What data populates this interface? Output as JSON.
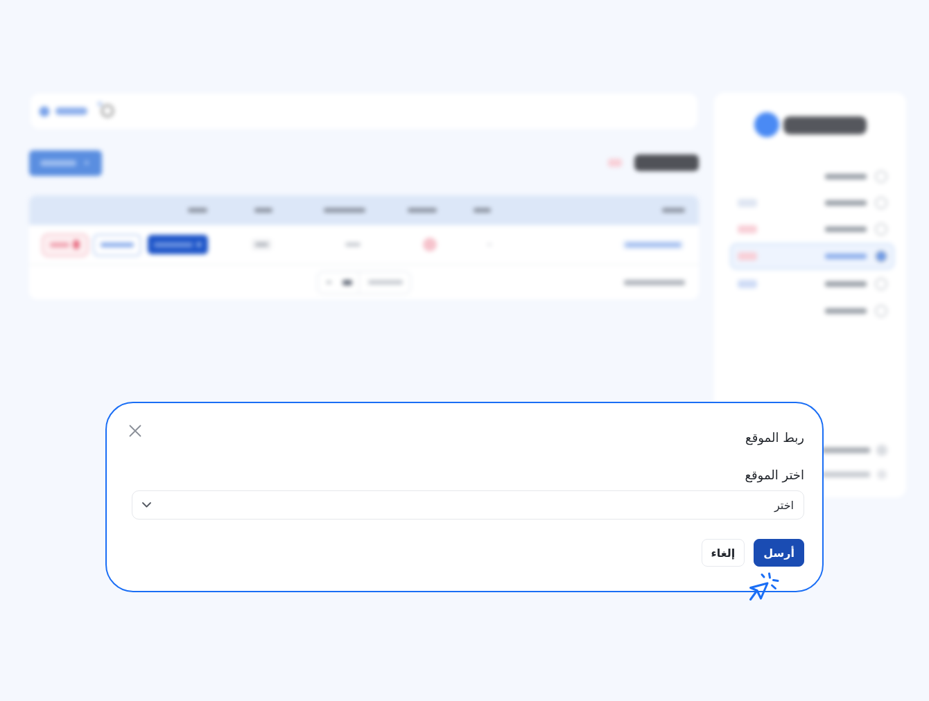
{
  "background": {
    "blurred": true
  },
  "dialog": {
    "title": "ربط الموقع",
    "field": {
      "label": "اختر الموقع",
      "placeholder": "اختر"
    },
    "buttons": [
      {
        "label": "أرسل",
        "kind": "primary"
      },
      {
        "label": "إلغاء",
        "kind": "secondary"
      }
    ]
  }
}
